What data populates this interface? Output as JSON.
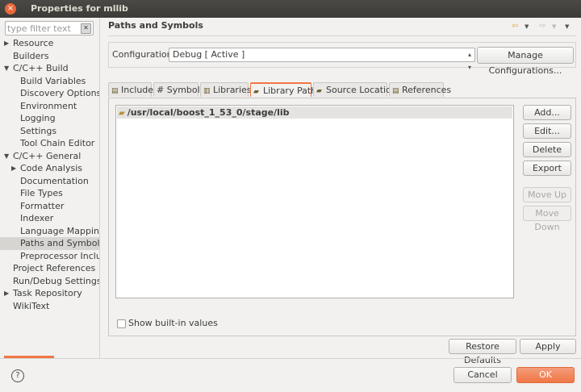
{
  "window": {
    "title": "Properties for mllib"
  },
  "filter": {
    "placeholder": "type filter text"
  },
  "tree": [
    {
      "label": "Resource",
      "expandable": true
    },
    {
      "label": "Builders"
    },
    {
      "label": "C/C++ Build",
      "expanded": true
    },
    {
      "label": "Build Variables",
      "child": true
    },
    {
      "label": "Discovery Options",
      "child": true
    },
    {
      "label": "Environment",
      "child": true
    },
    {
      "label": "Logging",
      "child": true
    },
    {
      "label": "Settings",
      "child": true
    },
    {
      "label": "Tool Chain Editor",
      "child": true
    },
    {
      "label": "C/C++ General",
      "expanded": true
    },
    {
      "label": "Code Analysis",
      "child": true,
      "expandable": true
    },
    {
      "label": "Documentation",
      "child": true
    },
    {
      "label": "File Types",
      "child": true
    },
    {
      "label": "Formatter",
      "child": true
    },
    {
      "label": "Indexer",
      "child": true
    },
    {
      "label": "Language Mappings",
      "child": true
    },
    {
      "label": "Paths and Symbols",
      "child": true,
      "selected": true
    },
    {
      "label": "Preprocessor Include",
      "child": true
    },
    {
      "label": "Project References"
    },
    {
      "label": "Run/Debug Settings"
    },
    {
      "label": "Task Repository",
      "expandable": true
    },
    {
      "label": "WikiText"
    }
  ],
  "panel": {
    "title": "Paths and Symbols"
  },
  "configuration": {
    "label": "Configuration:",
    "value": "Debug  [ Active ]",
    "manage_button": "Manage Configurations..."
  },
  "tabs": [
    {
      "label": "Includes",
      "icon": "includes-icon"
    },
    {
      "label": "# Symbols",
      "icon": ""
    },
    {
      "label": "Libraries",
      "icon": "libraries-icon"
    },
    {
      "label": "Library Paths",
      "icon": "folder-icon",
      "active": true
    },
    {
      "label": "Source Location",
      "icon": "source-folder-icon"
    },
    {
      "label": "References",
      "icon": "references-icon"
    }
  ],
  "library_paths": [
    "/usr/local/boost_1_53_0/stage/lib"
  ],
  "side_buttons": {
    "add": "Add...",
    "edit": "Edit...",
    "delete": "Delete",
    "export": "Export",
    "move_up": "Move Up",
    "move_down": "Move Down"
  },
  "show_builtin": "Show built-in values",
  "restore_defaults": "Restore Defaults",
  "apply": "Apply",
  "cancel": "Cancel",
  "ok": "OK",
  "colors": {
    "accent": "#f07746",
    "titlebar": "#3c3b37"
  }
}
